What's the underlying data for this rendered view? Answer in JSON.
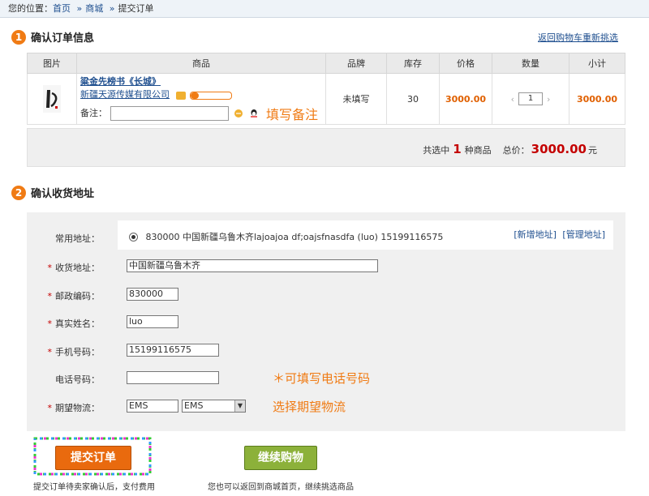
{
  "breadcrumb": {
    "prefix": "您的位置：",
    "home": "首页",
    "mall": "商城",
    "current": "提交订单",
    "sep": "»"
  },
  "step1": {
    "num": "1",
    "title": "确认订单信息"
  },
  "back_link": "返回购物车重新挑选",
  "table": {
    "headers": [
      "图片",
      "商品",
      "品牌",
      "库存",
      "价格",
      "数量",
      "小计"
    ],
    "row": {
      "name": "粱金先榜书《长城》",
      "vendor": "新疆天源传媒有限公司",
      "remark_label": "备注：",
      "remark_value": "",
      "remark_hint": "填写备注",
      "brand": "未填写",
      "stock": "30",
      "price": "3000.00",
      "qty": "1",
      "subtotal": "3000.00",
      "vendor_level": 0.2
    }
  },
  "summary": {
    "pre": "共选中",
    "count": "1",
    "unit": "种商品",
    "total_label": "总价：",
    "total": "3000.00",
    "currency": "元"
  },
  "step2": {
    "num": "2",
    "title": "确认收货地址"
  },
  "address": {
    "common_label": "常用地址：",
    "common_value": "830000 中国新疆乌鲁木齐lajoajoa df;oajsfnasdfa (luo) 15199116575",
    "new_link": "[新增地址]",
    "manage_link": "[管理地址]",
    "fields": {
      "addr_label": "收货地址：",
      "addr_value": "中国新疆乌鲁木齐",
      "zip_label": "邮政编码：",
      "zip_value": "830000",
      "name_label": "真实姓名：",
      "name_value": "luo",
      "mobile_label": "手机号码：",
      "mobile_value": "15199116575",
      "phone_label": "电话号码：",
      "phone_value": "",
      "phone_hint": "＊可填写电话号码",
      "ship_label": "期望物流：",
      "ship_text": "EMS",
      "ship_select": "EMS",
      "ship_hint": "选择期望物流"
    },
    "req": "*"
  },
  "buttons": {
    "submit": "提交订单",
    "submit_caption": "提交订单待卖家确认后，支付费用",
    "continue": "继续购物",
    "continue_caption": "您也可以返回到商城首页，继续挑选商品"
  },
  "colors": {
    "accent": "#f07b14",
    "link": "#1f4f8f",
    "price": "#e06000",
    "total": "#c40000",
    "submit": "#e96a0e",
    "continue": "#8cb13a"
  }
}
